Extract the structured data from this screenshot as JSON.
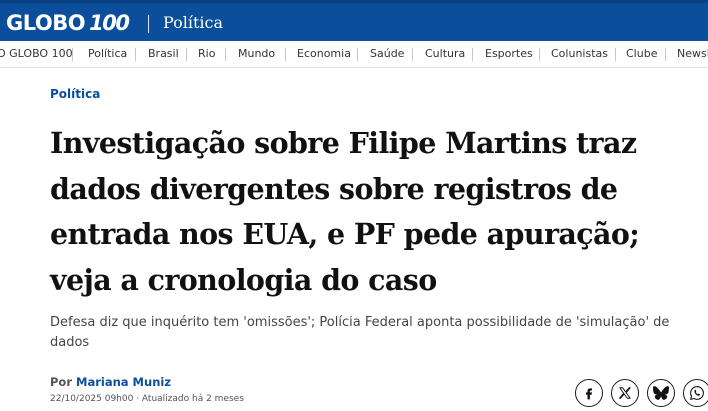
{
  "header": {
    "logo_text": "GLOBO",
    "logo_number": "100",
    "section": "Política"
  },
  "nav": {
    "items": [
      "O GLOBO 100",
      "Política",
      "Brasil",
      "Rio",
      "Mundo",
      "Economia",
      "Saúde",
      "Cultura",
      "Esportes",
      "Colunistas",
      "Clube",
      "Newsl"
    ]
  },
  "article": {
    "category": "Política",
    "headline": "Investigação sobre Filipe Martins traz dados divergentes sobre registros de entrada nos EUA, e PF pede apuração; veja a cronologia do caso",
    "subtitle": "Defesa diz que inquérito tem 'omissões'; Polícia Federal aponta possibilidade de 'simulação' de dados",
    "byline_prefix": "Por",
    "author": "Mariana Muniz",
    "dateline": "22/10/2025 09h00 · Atualizado há 2 meses"
  },
  "share": {
    "icons": [
      "facebook-icon",
      "x-icon",
      "bluesky-icon",
      "whatsapp-icon"
    ]
  },
  "colors": {
    "brand_blue": "#0b4f9c",
    "text": "#111111"
  }
}
